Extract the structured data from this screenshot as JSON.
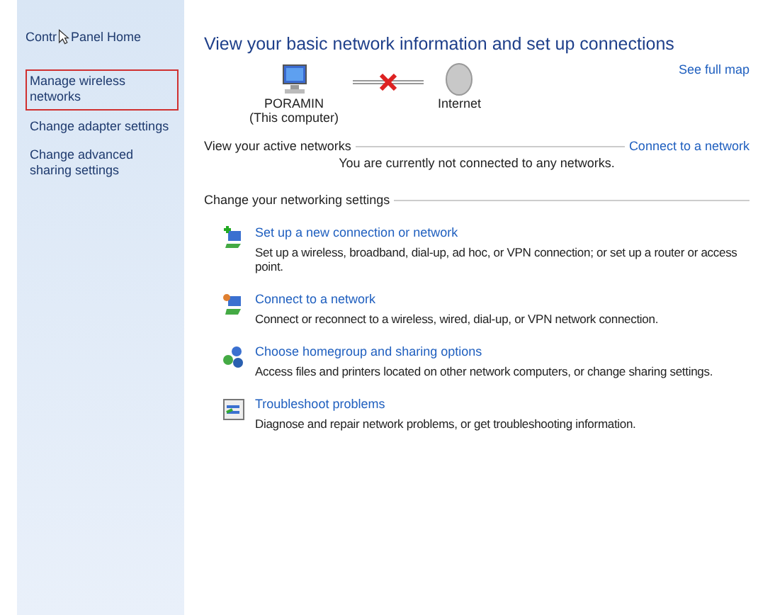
{
  "sidebar": {
    "home_link": {
      "before": "Contr",
      "after": "Panel Home"
    },
    "items": [
      {
        "label": "Manage wireless networks",
        "selected": true
      },
      {
        "label": "Change adapter settings",
        "selected": false
      },
      {
        "label": "Change advanced sharing settings",
        "selected": false
      }
    ]
  },
  "main": {
    "title": "View your basic network information and set up connections",
    "see_full_map": "See full map",
    "map": {
      "computer_name": "PORAMIN",
      "computer_note": "(This computer)",
      "internet_label": "Internet",
      "connected": false
    },
    "active_networks": {
      "heading": "View your active networks",
      "link": "Connect to a network",
      "message": "You are currently not connected to any networks."
    },
    "settings": {
      "heading": "Change your networking settings",
      "tasks": [
        {
          "kind": "new-connection",
          "link": "Set up a new connection or network",
          "description": "Set up a wireless, broadband, dial-up, ad hoc, or VPN connection; or set up a router or access point."
        },
        {
          "kind": "connect",
          "link": "Connect to a network",
          "description": "Connect or reconnect to a wireless, wired, dial-up, or VPN network connection."
        },
        {
          "kind": "homegroup",
          "link": "Choose homegroup and sharing options",
          "description": "Access files and printers located on other network computers, or change sharing settings."
        },
        {
          "kind": "troubleshoot",
          "link": "Troubleshoot problems",
          "description": "Diagnose and repair network problems, or get troubleshooting information."
        }
      ]
    }
  }
}
